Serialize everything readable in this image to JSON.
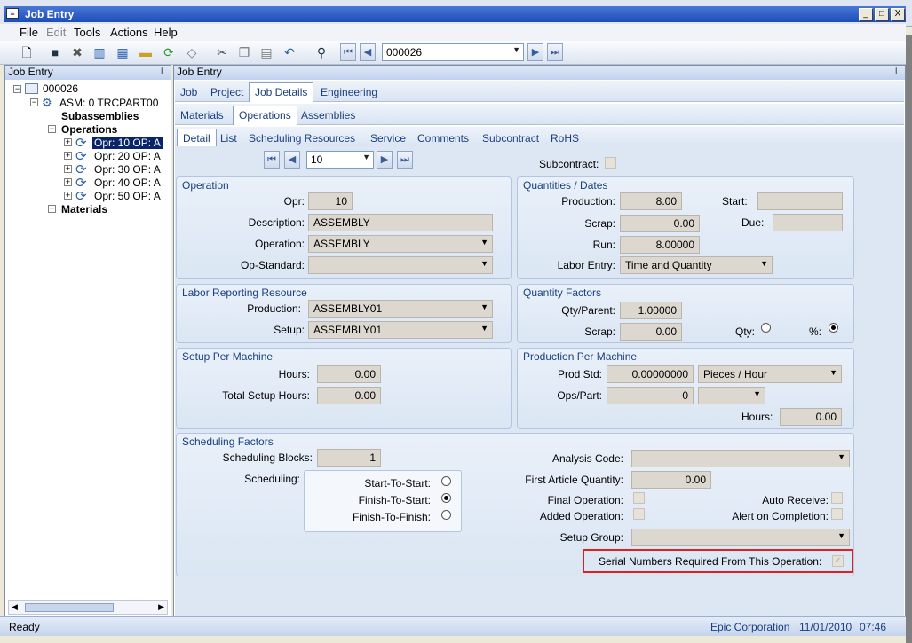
{
  "window": {
    "title": "Job Entry",
    "min": "_",
    "max": "□",
    "close": "X"
  },
  "menu": [
    "File",
    "Edit",
    "Tools",
    "Actions",
    "Help"
  ],
  "toolbar": {
    "record": "000026"
  },
  "left_panel": {
    "header": "Job Entry",
    "tree": {
      "root": "000026",
      "asm": "ASM: 0 TRCPART00",
      "subassemblies": "Subassemblies",
      "operations": "Operations",
      "ops": [
        "Opr: 10 OP: A",
        "Opr: 20 OP: A",
        "Opr: 30 OP: A",
        "Opr: 40 OP: A",
        "Opr: 50 OP: A"
      ],
      "materials": "Materials"
    }
  },
  "right_panel": {
    "header": "Job Entry",
    "tabs1": [
      "Job",
      "Project",
      "Job Details",
      "Engineering"
    ],
    "tabs2": [
      "Materials",
      "Operations",
      "Assemblies"
    ],
    "tabs3": [
      "Detail",
      "List",
      "Scheduling Resources",
      "Service",
      "Comments",
      "Subcontract",
      "RoHS"
    ],
    "nav_value": "10",
    "subcontract_label": "Subcontract:"
  },
  "operation": {
    "title": "Operation",
    "opr_label": "Opr:",
    "opr": "10",
    "desc_label": "Description:",
    "desc": "ASSEMBLY",
    "op_label": "Operation:",
    "op": "ASSEMBLY",
    "std_label": "Op-Standard:",
    "std": ""
  },
  "qty_dates": {
    "title": "Quantities / Dates",
    "prod_label": "Production:",
    "prod": "8.00",
    "scrap_label": "Scrap:",
    "scrap": "0.00",
    "run_label": "Run:",
    "run": "8.00000",
    "labor_label": "Labor Entry:",
    "labor": "Time and Quantity",
    "start_label": "Start:",
    "due_label": "Due:"
  },
  "labor_res": {
    "title": "Labor Reporting Resource",
    "prod_label": "Production:",
    "prod": "ASSEMBLY01",
    "setup_label": "Setup:",
    "setup": "ASSEMBLY01"
  },
  "qty_factors": {
    "title": "Quantity Factors",
    "qp_label": "Qty/Parent:",
    "qp": "1.00000",
    "scrap_label": "Scrap:",
    "scrap": "0.00",
    "qty_label": "Qty:",
    "pct_label": "%:"
  },
  "setup_machine": {
    "title": "Setup Per Machine",
    "hours_label": "Hours:",
    "hours": "0.00",
    "total_label": "Total Setup Hours:",
    "total": "0.00"
  },
  "prod_machine": {
    "title": "Production Per Machine",
    "std_label": "Prod Std:",
    "std": "0.00000000",
    "unit": "Pieces / Hour",
    "ops_label": "Ops/Part:",
    "ops": "0",
    "hours_label": "Hours:",
    "hours": "0.00"
  },
  "scheduling": {
    "title": "Scheduling Factors",
    "blocks_label": "Scheduling Blocks:",
    "blocks": "1",
    "sched_label": "Scheduling:",
    "opt1": "Start-To-Start:",
    "opt2": "Finish-To-Start:",
    "opt3": "Finish-To-Finish:",
    "analysis_label": "Analysis Code:",
    "faq_label": "First Article Quantity:",
    "faq": "0.00",
    "final_label": "Final Operation:",
    "added_label": "Added Operation:",
    "auto_label": "Auto Receive:",
    "alert_label": "Alert on Completion:",
    "setup_group_label": "Setup Group:",
    "serial_label": "Serial Numbers Required From This Operation:"
  },
  "status": {
    "left": "Ready",
    "company": "Epic Corporation",
    "date": "11/01/2010",
    "time": "07:46"
  },
  "colors": {
    "accent": "#1a3f80",
    "highlight": "#e02020",
    "selection": "#0a246a"
  }
}
